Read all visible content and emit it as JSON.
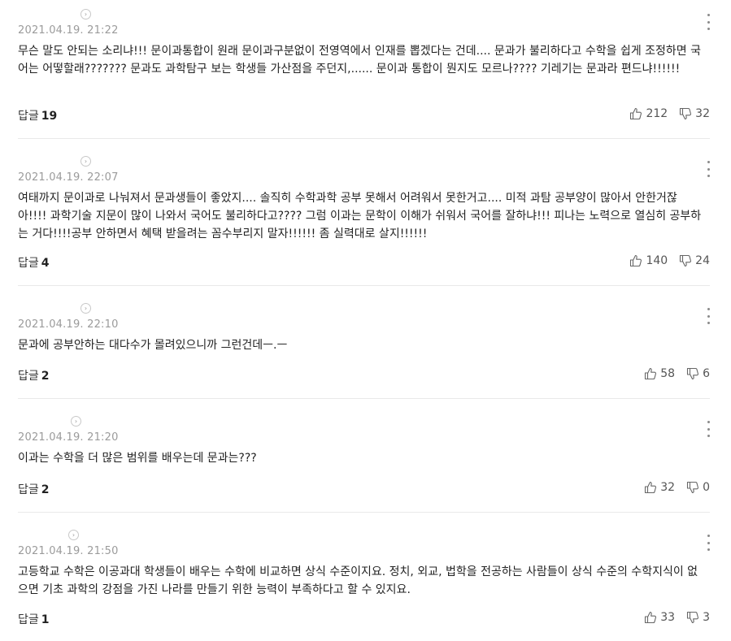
{
  "reply_label": "답글",
  "comments": [
    {
      "date": "2021.04.19. 21:22",
      "text": "무슨 말도 안되는 소리냐!!! 문이과통합이 원래 문이과구분없이 전영역에서 인재를 뽑겠다는 건데.... 문과가 불리하다고 수학을 쉽게 조정하면 국어는 어떻할래??????? 문과도 과학탐구 보는 학생들 가산점을 주던지,...... 문이과 통합이 뭔지도 모르나???? 기레기는 문과라 편드냐!!!!!!",
      "reply_count": "19",
      "likes": "212",
      "dislikes": "32"
    },
    {
      "date": "2021.04.19. 22:07",
      "text": "여태까지 문이과로 나눠져서 문과생들이 좋았지.... 솔직히 수학과학 공부 못해서 어려워서 못한거고.... 미적 과탐 공부양이 많아서 안한거잖아!!!! 과학기술 지문이 많이 나와서 국어도 불리하다고???? 그럼 이과는 문학이 이해가 쉬워서 국어를 잘하냐!!! 피나는 노력으로 열심히 공부하는 거다!!!!공부 안하면서 혜택 받을려는 꼼수부리지 말자!!!!!! 좀 실력대로 살지!!!!!!",
      "reply_count": "4",
      "likes": "140",
      "dislikes": "24"
    },
    {
      "date": "2021.04.19. 22:10",
      "text": "문과에 공부안하는 대다수가 몰려있으니까 그런건데ㅡ.ㅡ",
      "reply_count": "2",
      "likes": "58",
      "dislikes": "6"
    },
    {
      "date": "2021.04.19. 21:20",
      "text": "이과는 수학을 더 많은 범위를 배우는데 문과는???",
      "reply_count": "2",
      "likes": "32",
      "dislikes": "0"
    },
    {
      "date": "2021.04.19. 21:50",
      "text": "고등학교 수학은 이공과대 학생들이 배우는 수학에 비교하면 상식 수준이지요. 정치, 외교, 법학을 전공하는 사람들이 상식 수준의 수학지식이 없으면 기초 과학의 강점을 가진 나라를 만들기 위한 능력이 부족하다고 할 수 있지요.",
      "reply_count": "1",
      "likes": "33",
      "dislikes": "3"
    }
  ],
  "icons": {
    "profile_link": "chevron-right-circle-icon",
    "more": "vertical-dots-icon",
    "like": "thumbs-up-icon",
    "dislike": "thumbs-down-icon"
  },
  "colors": {
    "date": "#9b9b9b",
    "divider": "#e9e9e9",
    "text": "#222222"
  }
}
